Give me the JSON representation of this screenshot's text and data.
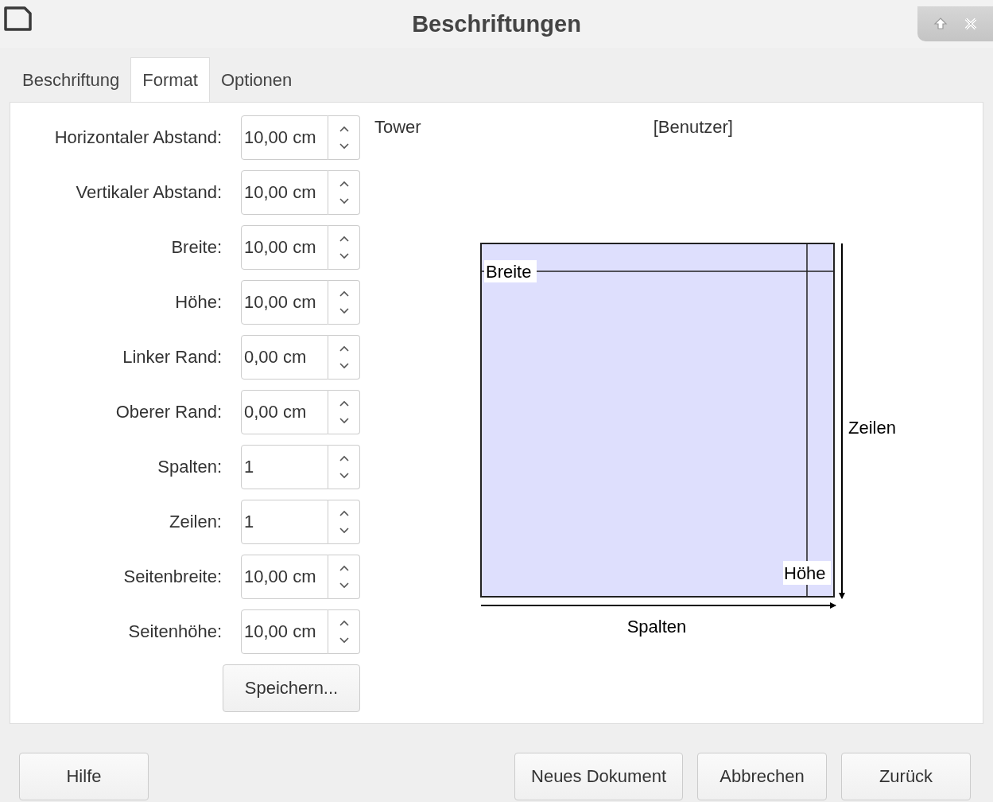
{
  "window": {
    "title": "Beschriftungen"
  },
  "tabs": [
    {
      "label": "Beschriftung",
      "selected": false
    },
    {
      "label": "Format",
      "selected": true
    },
    {
      "label": "Optionen",
      "selected": false
    }
  ],
  "fields": [
    {
      "label": "Horizontaler Abstand:",
      "value": "10,00 cm"
    },
    {
      "label": "Vertikaler Abstand:",
      "value": "10,00 cm"
    },
    {
      "label": "Breite:",
      "value": "10,00 cm"
    },
    {
      "label": "Höhe:",
      "value": "10,00 cm"
    },
    {
      "label": "Linker Rand:",
      "value": "0,00 cm"
    },
    {
      "label": "Oberer Rand:",
      "value": "0,00 cm"
    },
    {
      "label": "Spalten:",
      "value": "1"
    },
    {
      "label": "Zeilen:",
      "value": "1"
    },
    {
      "label": "Seitenbreite:",
      "value": "10,00 cm"
    },
    {
      "label": "Seitenhöhe:",
      "value": "10,00 cm"
    }
  ],
  "save_button": "Speichern...",
  "preview": {
    "brand": "Tower",
    "type": "[Benutzer]",
    "width_label": "Breite",
    "height_label": "Höhe",
    "rows_label": "Zeilen",
    "columns_label": "Spalten"
  },
  "buttons": {
    "help": "Hilfe",
    "new_document": "Neues Dokument",
    "cancel": "Abbrechen",
    "back": "Zurück"
  }
}
